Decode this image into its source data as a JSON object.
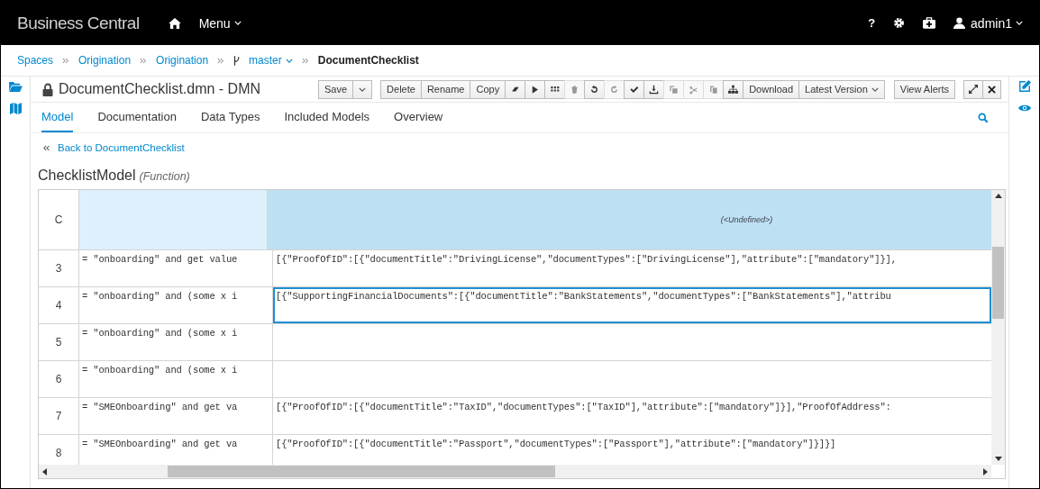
{
  "navbar": {
    "brand": "Business Central",
    "menu": "Menu",
    "help": "?",
    "user": "admin1"
  },
  "breadcrumb": {
    "items": [
      "Spaces",
      "Origination",
      "Origination"
    ],
    "branch": "master",
    "current": "DocumentChecklist"
  },
  "editor": {
    "title": "DocumentChecklist.dmn - DMN",
    "toolbar": {
      "save": "Save",
      "edit_buttons": [
        "Delete",
        "Rename",
        "Copy"
      ],
      "icon_buttons": [
        {
          "disabled": false
        },
        {
          "disabled": false
        },
        {
          "disabled": false
        },
        {
          "disabled": true
        },
        {
          "disabled": false
        },
        {
          "disabled": true
        },
        {
          "disabled": false
        },
        {
          "disabled": false
        },
        {
          "disabled": true
        },
        {
          "disabled": true
        },
        {
          "disabled": true
        },
        {
          "disabled": false
        }
      ],
      "download": "Download",
      "version": "Latest Version",
      "alerts": "View Alerts"
    },
    "tabs": [
      {
        "label": "Model",
        "selected": true
      },
      {
        "label": "Documentation",
        "selected": false
      },
      {
        "label": "Data Types",
        "selected": false
      },
      {
        "label": "Included Models",
        "selected": false
      },
      {
        "label": "Overview",
        "selected": false
      }
    ]
  },
  "back_link": "Back to DocumentChecklist",
  "heading": {
    "name": "ChecklistModel",
    "kind": "(Function)"
  },
  "table": {
    "corner": "C",
    "column_2_header": "(<Undefined>)",
    "rows": [
      {
        "number": "3",
        "condition": "= \"onboarding\" and get value",
        "result": "[{\"ProofOfID\":[{\"documentTitle\":\"DrivingLicense\",\"documentTypes\":[\"DrivingLicense\"],\"attribute\":[\"mandatory\"]}],",
        "selected": false
      },
      {
        "number": "4",
        "condition": "= \"onboarding\" and (some x i",
        "result": "[{\"SupportingFinancialDocuments\":[{\"documentTitle\":\"BankStatements\",\"documentTypes\":[\"BankStatements\"],\"attribu",
        "selected": true
      },
      {
        "number": "5",
        "condition": "= \"onboarding\" and (some x i",
        "result": "",
        "selected": false
      },
      {
        "number": "6",
        "condition": "= \"onboarding\" and (some x i",
        "result": "",
        "selected": false
      },
      {
        "number": "7",
        "condition": "= \"SMEOnboarding\" and get va",
        "result": "[{\"ProofOfID\":[{\"documentTitle\":\"TaxID\",\"documentTypes\":[\"TaxID\"],\"attribute\":[\"mandatory\"]}],\"ProofOfAddress\":",
        "selected": false
      },
      {
        "number": "8",
        "condition": "= \"SMEOnboarding\" and get va",
        "result": "[{\"ProofOfID\":[{\"documentTitle\":\"Passport\",\"documentTypes\":[\"Passport\"],\"attribute\":[\"mandatory\"]}]}]",
        "selected": false
      }
    ]
  }
}
